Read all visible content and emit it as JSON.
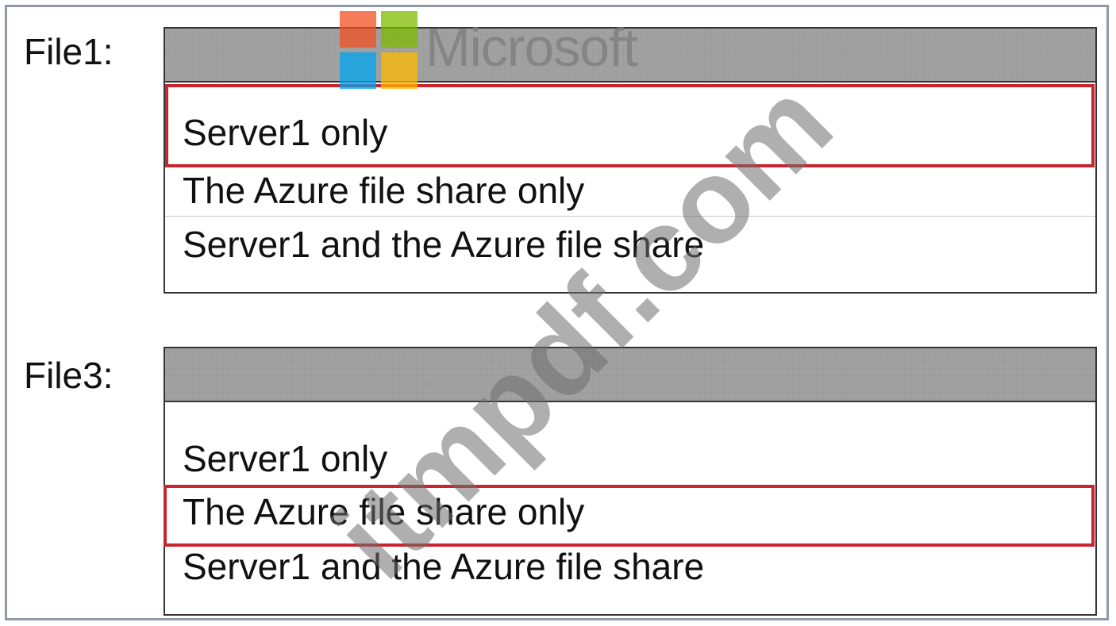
{
  "watermarks": {
    "logo_text": "Microsoft",
    "site_text": "itmpdf.com",
    "logo_colors": [
      "#f25022",
      "#7fba00",
      "#00a4ef",
      "#ffb900"
    ]
  },
  "questions": [
    {
      "label": "File1:",
      "selected": "",
      "options": [
        "Server1 only",
        "The Azure file share only",
        "Server1 and the Azure file share"
      ],
      "highlighted_option": "Server1 only"
    },
    {
      "label": "File3:",
      "selected": "",
      "options": [
        "Server1 only",
        "The Azure file share only",
        "Server1 and the Azure file share"
      ],
      "highlighted_option": "The Azure file share only"
    }
  ],
  "colors": {
    "highlight": "#c8262e",
    "dropdown_header": "#a4a4a4",
    "frame_border": "#8e9aa6"
  }
}
